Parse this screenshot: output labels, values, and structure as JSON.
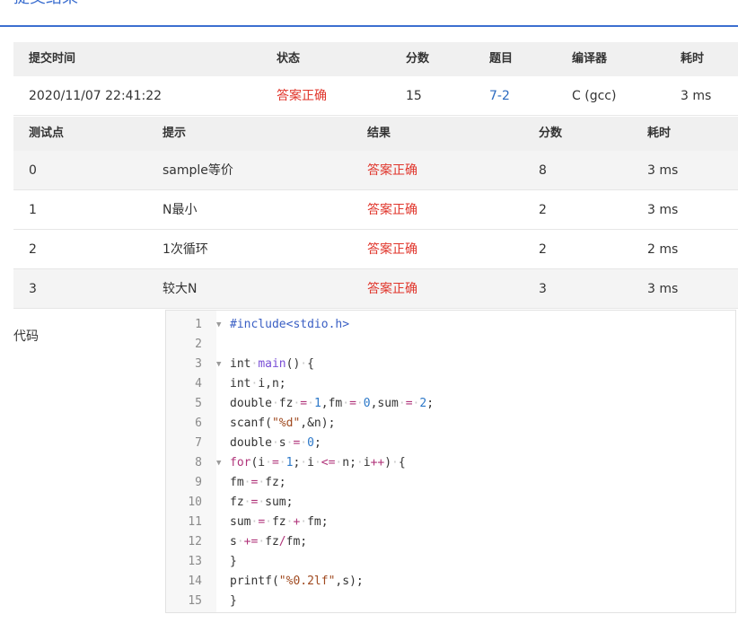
{
  "page": {
    "title": "提交结果"
  },
  "summary": {
    "headers": [
      "提交时间",
      "状态",
      "分数",
      "题目",
      "编译器",
      "耗时"
    ],
    "row": {
      "time": "2020/11/07 22:41:22",
      "status": "答案正确",
      "score": "15",
      "problem": "7-2",
      "compiler": "C (gcc)",
      "duration": "3 ms"
    }
  },
  "tests": {
    "headers": [
      "测试点",
      "提示",
      "结果",
      "分数",
      "耗时"
    ],
    "rows": [
      {
        "id": "0",
        "hint": "sample等价",
        "result": "答案正确",
        "score": "8",
        "time": "3 ms"
      },
      {
        "id": "1",
        "hint": "N最小",
        "result": "答案正确",
        "score": "2",
        "time": "3 ms"
      },
      {
        "id": "2",
        "hint": "1次循环",
        "result": "答案正确",
        "score": "2",
        "time": "2 ms"
      },
      {
        "id": "3",
        "hint": "较大N",
        "result": "答案正确",
        "score": "3",
        "time": "3 ms"
      }
    ]
  },
  "code": {
    "label": "代码",
    "lines": [
      "#include<stdio.h>",
      "",
      "int main() {",
      "int i,n;",
      "double fz = 1,fm = 0,sum = 2;",
      "scanf(\"%d\",&n);",
      "double s = 0;",
      "for(i = 1; i <= n; i++) {",
      "fm = fz;",
      "fz = sum;",
      "sum = fz + fm;",
      "s += fz/fm;",
      "}",
      "printf(\"%0.2lf\",s);",
      "}"
    ]
  }
}
